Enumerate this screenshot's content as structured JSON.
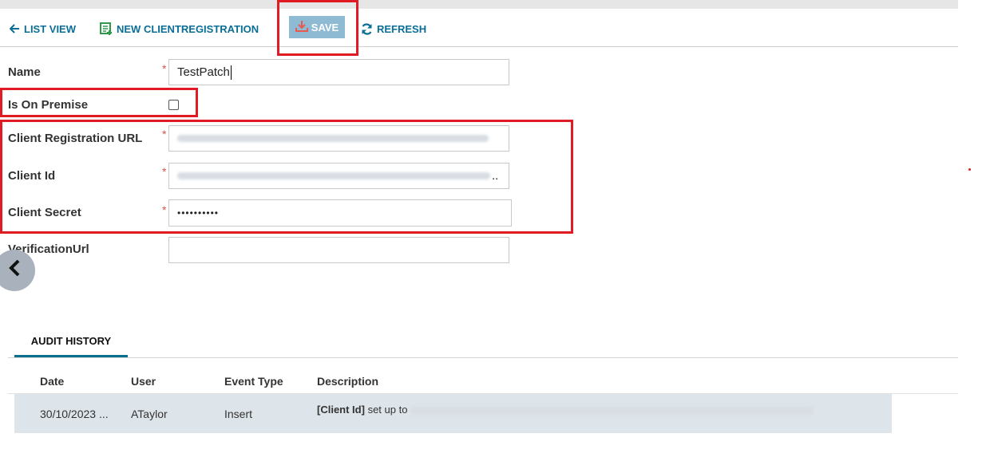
{
  "toolbar": {
    "list_view": "LIST VIEW",
    "new_registration": "NEW CLIENTREGISTRATION",
    "save": "SAVE",
    "refresh": "REFRESH"
  },
  "form": {
    "name_label": "Name",
    "name_value": "TestPatch",
    "on_premise_label": "Is On Premise",
    "on_premise_checked": false,
    "client_url_label": "Client Registration URL",
    "client_id_label": "Client Id",
    "client_id_suffix": "..",
    "client_secret_label": "Client Secret",
    "client_secret_value": "••••••••••",
    "verification_label": "VerificationUrl",
    "required_mark": "*"
  },
  "audit": {
    "tab_label": "AUDIT HISTORY",
    "columns": [
      "Date",
      "User",
      "Event Type",
      "Description"
    ],
    "rows": [
      {
        "date": "30/10/2023 ...",
        "user": "ATaylor",
        "event_type": "Insert",
        "description_field": "[Client Id]",
        "description_text": "set up to"
      }
    ]
  },
  "colors": {
    "accent": "#0a6e96",
    "highlight": "#e01b24",
    "save_bg": "#8fbad3",
    "row_bg": "#dde4ea"
  }
}
